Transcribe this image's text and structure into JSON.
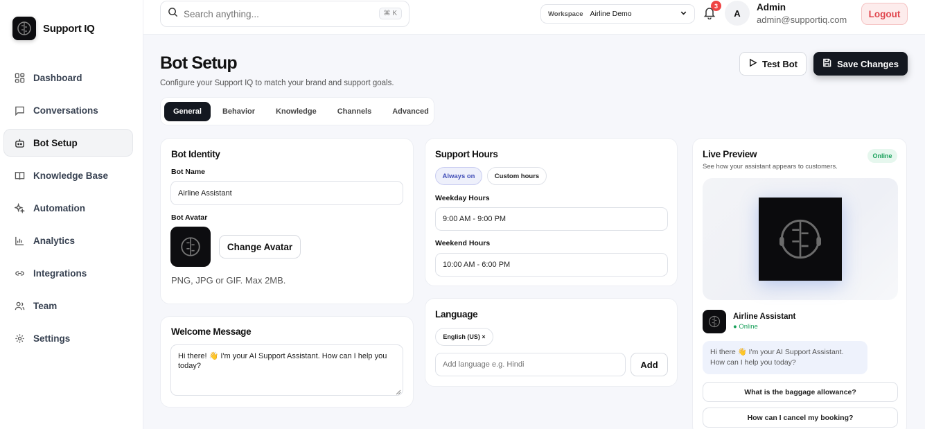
{
  "brand": {
    "name": "Support IQ",
    "logo_icon": "robot-brain-icon"
  },
  "sidebar": {
    "items": [
      {
        "label": "Dashboard",
        "icon": "grid-icon",
        "active": false
      },
      {
        "label": "Conversations",
        "icon": "chat-icon",
        "active": false
      },
      {
        "label": "Bot Setup",
        "icon": "bot-icon",
        "active": true
      },
      {
        "label": "Knowledge Base",
        "icon": "book-icon",
        "active": false
      },
      {
        "label": "Automation",
        "icon": "sparkle-icon",
        "active": false
      },
      {
        "label": "Analytics",
        "icon": "bar-chart-icon",
        "active": false
      },
      {
        "label": "Integrations",
        "icon": "link-icon",
        "active": false
      },
      {
        "label": "Team",
        "icon": "users-icon",
        "active": false
      },
      {
        "label": "Settings",
        "icon": "gear-icon",
        "active": false
      }
    ]
  },
  "topbar": {
    "search_placeholder": "Search anything...",
    "search_shortcut": "⌘ K",
    "workspace_label": "Workspace",
    "workspace_value": "Airline Demo",
    "notification_count": "3",
    "avatar_initial": "A",
    "user_name": "Admin",
    "user_email": "admin@supportiq.com",
    "logout_label": "Logout"
  },
  "header": {
    "title": "Bot Setup",
    "subtitle": "Configure your Support IQ to match your brand and support goals.",
    "test_bot_label": "Test Bot",
    "save_label": "Save Changes"
  },
  "tabs": [
    {
      "label": "General",
      "active": true
    },
    {
      "label": "Behavior",
      "active": false
    },
    {
      "label": "Knowledge",
      "active": false
    },
    {
      "label": "Channels",
      "active": false
    },
    {
      "label": "Advanced",
      "active": false
    }
  ],
  "bot_identity": {
    "title": "Bot Identity",
    "name_label": "Bot Name",
    "name_value": "Airline Assistant",
    "avatar_label": "Bot Avatar",
    "change_avatar_label": "Change Avatar",
    "avatar_hint": "PNG, JPG or GIF. Max 2MB."
  },
  "welcome": {
    "title": "Welcome Message",
    "message": "Hi there! 👋 I'm your AI Support Assistant. How can I help you today?"
  },
  "support_hours": {
    "title": "Support Hours",
    "always_on_label": "Always on",
    "custom_hours_label": "Custom hours",
    "weekday_label": "Weekday Hours",
    "weekday_value": "9:00 AM - 9:00 PM",
    "weekend_label": "Weekend Hours",
    "weekend_value": "10:00 AM - 6:00 PM"
  },
  "language": {
    "title": "Language",
    "selected_tag": "English (US) ×",
    "add_placeholder": "Add language e.g. Hindi",
    "add_label": "Add"
  },
  "preview": {
    "title": "Live Preview",
    "subtitle": "See how your assistant appears to customers.",
    "status_badge": "Online",
    "bot_name": "Airline Assistant",
    "bot_status": "● Online",
    "bubble": "Hi there 👋 I'm your AI Support Assistant. How can I help you today?",
    "quick_replies": [
      "What is the baggage allowance?",
      "How can I cancel my booking?"
    ]
  },
  "colors": {
    "accent_dark": "#141820",
    "online_green": "#18a05a",
    "logout_red": "#e0454d",
    "badge_red": "#ef4444"
  }
}
